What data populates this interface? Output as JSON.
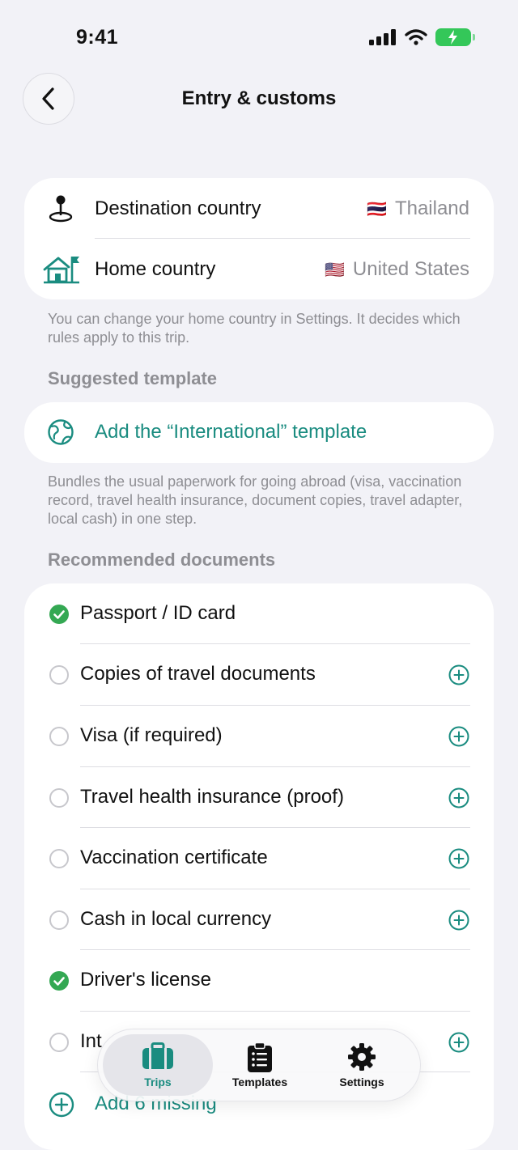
{
  "status_bar": {
    "time": "9:41"
  },
  "nav": {
    "title": "Entry & customs",
    "back_icon": "chevron-left-icon"
  },
  "countries": [
    {
      "label": "Destination country",
      "flag": "🇹🇭",
      "value": "Thailand",
      "icon": "map-pin-icon"
    },
    {
      "label": "Home country",
      "flag": "🇺🇸",
      "value": "United States",
      "icon": "home-flag-icon"
    }
  ],
  "home_country_note": "You can change your home country in Settings. It decides which rules apply to this trip.",
  "suggested_template": {
    "header": "Suggested template",
    "link": "Add the “International” template",
    "icon": "globe-icon",
    "description": "Bundles the usual paperwork for going abroad (visa, vaccination record, travel health insurance, document copies, travel adapter, local cash) in one step."
  },
  "documents": {
    "header": "Recommended documents",
    "items": [
      {
        "label": "Passport / ID card",
        "checked": true
      },
      {
        "label": "Copies of travel documents",
        "checked": false
      },
      {
        "label": "Visa (if required)",
        "checked": false
      },
      {
        "label": "Travel health insurance (proof)",
        "checked": false
      },
      {
        "label": "Vaccination certificate",
        "checked": false
      },
      {
        "label": "Cash in local currency",
        "checked": false
      },
      {
        "label": "Driver's license",
        "checked": true
      },
      {
        "label": "Int",
        "checked": false
      }
    ],
    "add_missing": "Add 6 missing"
  },
  "tabbar": {
    "tabs": [
      {
        "label": "Trips",
        "icon": "suitcase-icon",
        "active": true
      },
      {
        "label": "Templates",
        "icon": "clipboard-list-icon",
        "active": false
      },
      {
        "label": "Settings",
        "icon": "gear-icon",
        "active": false
      }
    ]
  },
  "colors": {
    "accent": "#1a8c80",
    "check": "#34a853",
    "background": "#f2f2f7",
    "battery": "#34c759"
  }
}
